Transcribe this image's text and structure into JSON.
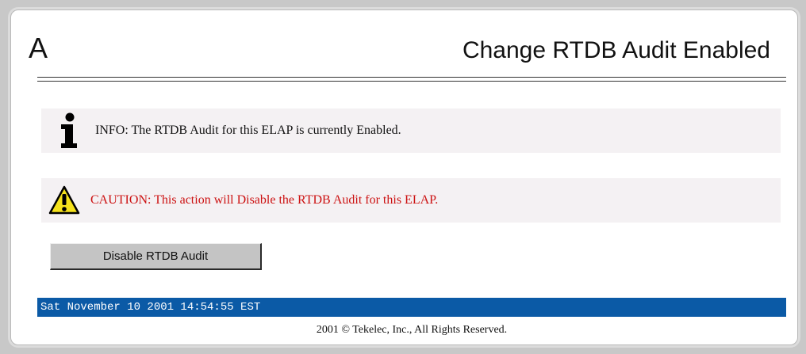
{
  "header": {
    "letter": "A",
    "title": "Change RTDB Audit Enabled"
  },
  "messages": {
    "info": {
      "icon": "info-icon",
      "text": "INFO: The RTDB Audit for this ELAP is currently Enabled."
    },
    "caution": {
      "icon": "warning-icon",
      "text": "CAUTION: This action will Disable the RTDB Audit for this ELAP.",
      "color": "#cc1111"
    }
  },
  "actions": {
    "disable_label": "Disable RTDB Audit"
  },
  "status": {
    "datetime": "Sat November 10 2001 14:54:55 EST",
    "color": "#0b5aa6"
  },
  "footer": {
    "copyright": "2001 © Tekelec, Inc., All Rights Reserved."
  }
}
